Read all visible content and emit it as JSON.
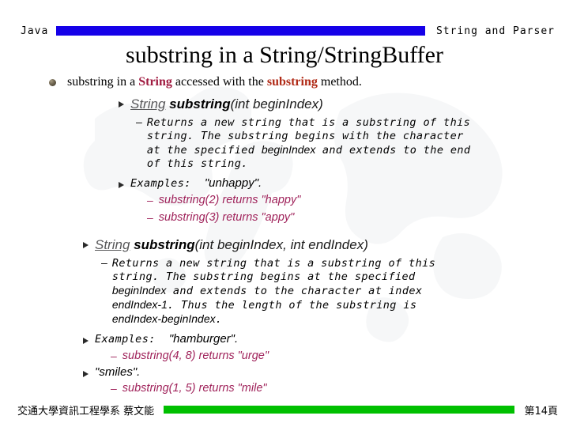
{
  "header": {
    "left_label": "Java",
    "right_label": "String and Parser",
    "bar_color": "#1500e8"
  },
  "title": "substring in a String/StringBuffer",
  "content": {
    "intro": {
      "pre": "substring in a ",
      "class_name": "String",
      "mid": " accessed with the ",
      "method_name": "substring",
      "post": " method."
    },
    "methods": [
      {
        "return_type": "String",
        "name": "substring",
        "args": "(int beginIndex)",
        "description_lines": [
          "Returns a new string that is a substring of this",
          "string. The substring begins with the character",
          "at the specified beginIndex and extends to the end",
          "of this string."
        ],
        "description_param": "beginIndex",
        "examples_label": "Examples:",
        "examples_value": "\"unhappy\".",
        "example_items": [
          "substring(2) returns \"happy\"",
          "substring(3) returns  \"appy\""
        ]
      },
      {
        "return_type": "String",
        "name": "substring",
        "args": "(int beginIndex, int endIndex)",
        "description_lines": [
          "Returns a new string that is a substring of this",
          "string. The substring begins at the specified",
          "beginIndex and extends to the character at index",
          "endIndex-1. Thus the length of the substring is",
          "endIndex-beginIndex."
        ],
        "examples_label": "Examples:",
        "examples_value": "\"hamburger\".",
        "example_items": [
          "substring(4, 8) returns \"urge\""
        ],
        "second_value": "\"smiles\".",
        "second_example_items": [
          "substring(1, 5) returns \"mile\""
        ]
      }
    ]
  },
  "footer": {
    "left_text": "交通大學資訊工程學系 蔡文能",
    "page_label": "第14頁",
    "bar_color": "#00c000"
  },
  "colors": {
    "class_red": "#a01a40",
    "method_red": "#b02a16",
    "example_red": "#a0235b",
    "signature_gray": "#58585a"
  }
}
